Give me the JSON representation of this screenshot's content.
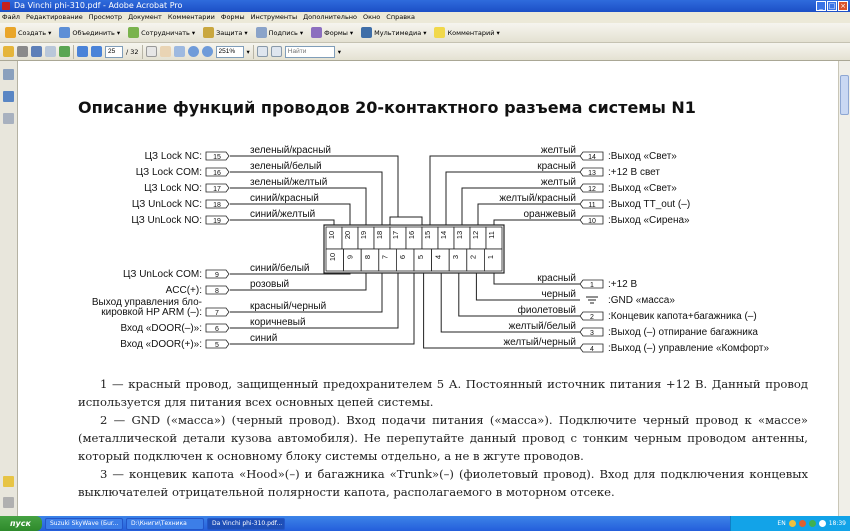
{
  "window": {
    "title": "Da Vinchi phi-310.pdf - Adobe Acrobat Pro"
  },
  "menu": [
    "Файл",
    "Редактирование",
    "Просмотр",
    "Документ",
    "Комментарии",
    "Формы",
    "Инструменты",
    "Дополнительно",
    "Окно",
    "Справка"
  ],
  "toolbar1": [
    "Создать",
    "Объединить",
    "Сотрудничать",
    "Защита",
    "Подпись",
    "Формы",
    "Мультимедиа",
    "Комментарий"
  ],
  "toolbar2": {
    "page_current": "25",
    "page_total": "/ 32",
    "zoom": "251%",
    "find_placeholder": "Найти"
  },
  "page": {
    "title": "Описание функций проводов 20-контактного разъема системы N1"
  },
  "diagram": {
    "left_top": [
      {
        "label": "ЦЗ Lock NC:",
        "pin": "15",
        "wire": "зеленый/красный"
      },
      {
        "label": "ЦЗ Lock COM:",
        "pin": "16",
        "wire": "зеленый/белый"
      },
      {
        "label": "ЦЗ Lock NO:",
        "pin": "17",
        "wire": "зеленый/желтый"
      },
      {
        "label": "ЦЗ UnLock NC:",
        "pin": "18",
        "wire": "синий/красный"
      },
      {
        "label": "ЦЗ UnLock NO:",
        "pin": "19",
        "wire": "синий/желтый"
      }
    ],
    "left_bottom": [
      {
        "label": "ЦЗ UnLock COM:",
        "pin": "9",
        "wire": "синий/белый"
      },
      {
        "label": "ACC(+):",
        "pin": "8",
        "wire": "розовый"
      },
      {
        "label": "Выход управления бло-",
        "label2": "кировкой HP ARM (–):",
        "pin": "7",
        "wire": "красный/черный"
      },
      {
        "label": "Вход «DOOR(–)»:",
        "pin": "6",
        "wire": "коричневый"
      },
      {
        "label": "Вход «DOOR(+)»:",
        "pin": "5",
        "wire": "синий"
      }
    ],
    "right_top": [
      {
        "wire": "желтый",
        "pin": "14",
        "label": ":Выход «Свет»"
      },
      {
        "wire": "красный",
        "pin": "13",
        "label": ":+12 В свет"
      },
      {
        "wire": "желтый",
        "pin": "12",
        "label": ":Выход «Свет»"
      },
      {
        "wire": "желтый/красный",
        "pin": "11",
        "label": ":Выход TT_out (–)"
      },
      {
        "wire": "оранжевый",
        "pin": "10",
        "label": ":Выход «Сирена»"
      }
    ],
    "right_bottom": [
      {
        "wire": "красный",
        "pin": "1",
        "label": ":+12 В"
      },
      {
        "wire": "черный",
        "pin": "",
        "label": ":GND «масса»"
      },
      {
        "wire": "фиолетовый",
        "pin": "2",
        "label": ":Концевик капота+багажника (–)"
      },
      {
        "wire": "желтый/белый",
        "pin": "3",
        "label": ":Выход (–) отпирание багажника"
      },
      {
        "wire": "желтый/черный",
        "pin": "4",
        "label": ":Выход (–) управление «Комфорт»"
      }
    ],
    "connector_top": [
      "10",
      "20",
      "19",
      "18",
      "17",
      "16",
      "15",
      "14",
      "13",
      "12",
      "11"
    ],
    "connector_bottom": [
      "10",
      "9",
      "8",
      "7",
      "6",
      "5",
      "4",
      "3",
      "2",
      "1"
    ]
  },
  "text": {
    "p1": "1 — красный провод, защищенный предохранителем 5 А. Постоянный источник питания +12 В. Данный провод используется для питания всех основных цепей системы.",
    "p2": "2 — GND («масса») (черный провод). Вход подачи питания («масса»). Подключите черный провод к «массе» (металлической детали кузова автомобиля). Не перепутайте данный провод с тонким черным проводом антенны, который подключен к основному блоку системы отдельно, а не в жгуте проводов.",
    "p3": "3 — концевик капота «Hood»(–) и багажника «Trunk»(–) (фиолетовый провод). Вход для подключения концевых выключателей отрицательной полярности капота, располагаемого в моторном отсеке."
  },
  "taskbar": {
    "start": "пуск",
    "tasks": [
      "Suzuki SkyWave (Бur...",
      "D:\\Книги\\Техника",
      "Da Vinchi phi-310.pdf..."
    ],
    "lang": "EN",
    "clock": "18:39"
  }
}
